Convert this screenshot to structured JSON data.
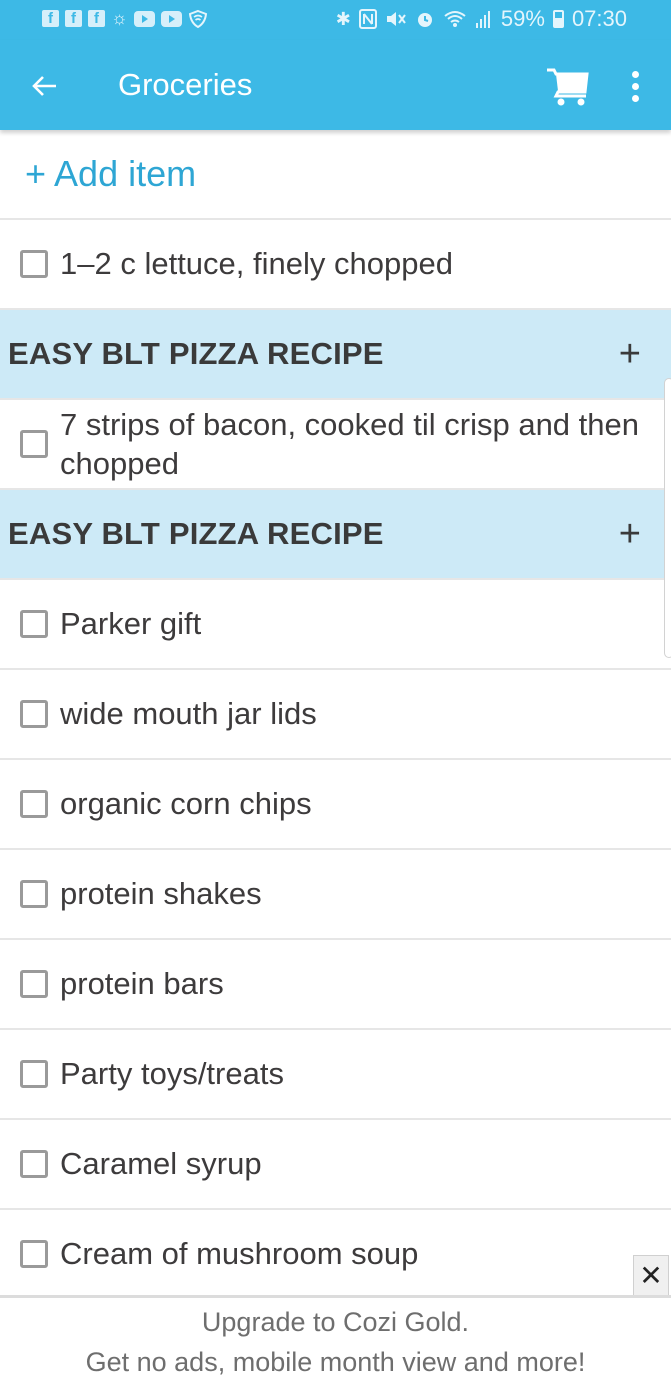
{
  "status_bar": {
    "left_icons": [
      "facebook-icon",
      "facebook-icon",
      "facebook-icon",
      "weather-icon",
      "youtube-icon",
      "youtube-icon",
      "shield-icon"
    ],
    "right_icons": [
      "bluetooth-icon",
      "nfc-icon",
      "mute-icon",
      "alarm-icon",
      "wifi-icon",
      "signal-icon"
    ],
    "battery": "59%",
    "time": "07:30"
  },
  "app_bar": {
    "title": "Groceries",
    "back_icon": "arrow-left-icon",
    "cart_icon": "cart-icon",
    "menu_icon": "more-vert-icon",
    "color": "#3db9e6"
  },
  "list": {
    "add_item_label": "+ Add item",
    "rows": [
      {
        "type": "item",
        "text": "1–2 c lettuce, finely chopped",
        "checked": false
      },
      {
        "type": "section",
        "text": "EASY BLT PIZZA RECIPE"
      },
      {
        "type": "item",
        "text": "7 strips of bacon, cooked til crisp and then chopped",
        "checked": false
      },
      {
        "type": "section",
        "text": "EASY BLT PIZZA RECIPE"
      },
      {
        "type": "item",
        "text": "Parker gift",
        "checked": false
      },
      {
        "type": "item",
        "text": "wide mouth jar lids",
        "checked": false
      },
      {
        "type": "item",
        "text": "organic corn chips",
        "checked": false
      },
      {
        "type": "item",
        "text": "protein shakes",
        "checked": false
      },
      {
        "type": "item",
        "text": "protein bars",
        "checked": false
      },
      {
        "type": "item",
        "text": "Party toys/treats",
        "checked": false
      },
      {
        "type": "item",
        "text": "Caramel syrup",
        "checked": false
      },
      {
        "type": "item",
        "text": "Cream of mushroom soup",
        "checked": false
      }
    ],
    "section_add_symbol": "+"
  },
  "ad": {
    "line1": "Upgrade to Cozi Gold.",
    "line2": "Get no ads, mobile month view and more!",
    "close_symbol": "✕"
  }
}
